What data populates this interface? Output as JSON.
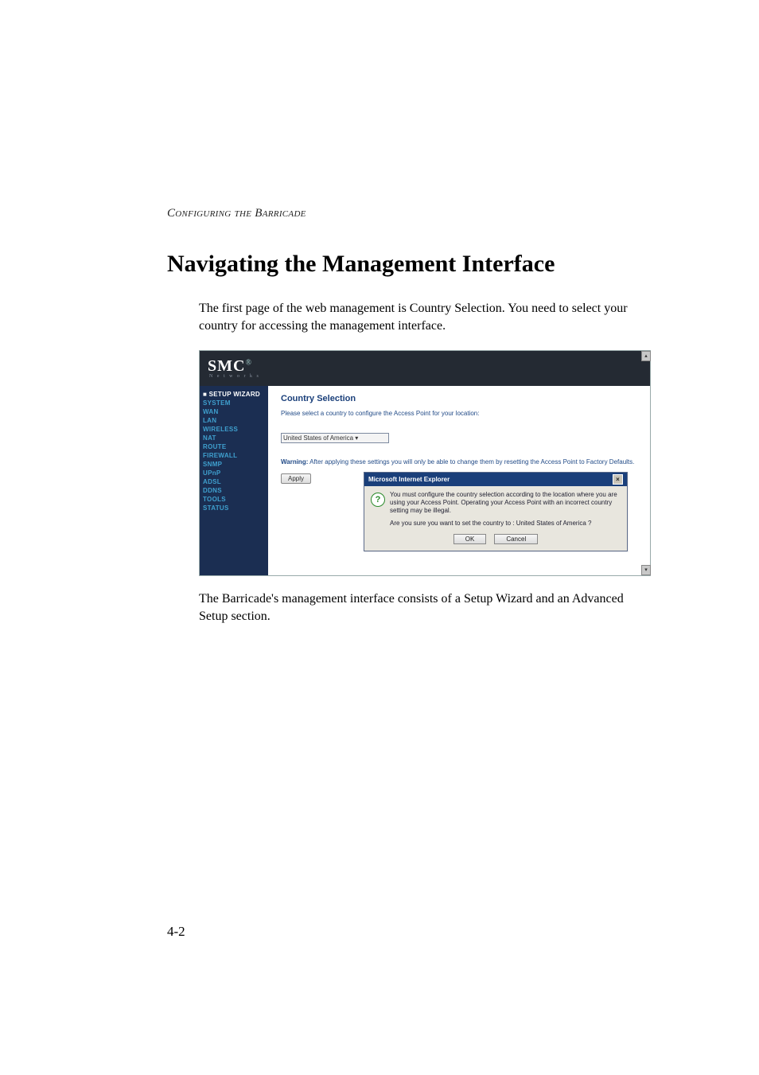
{
  "running_head": "Configuring the Barricade",
  "heading": "Navigating the Management Interface",
  "para1": "The first page of the web management is Country Selection. You need to select your country for accessing the management interface.",
  "para2": "The Barricade's management interface consists of a Setup Wizard and an Advanced Setup section.",
  "page_number": "4-2",
  "figure": {
    "brand": "SMC",
    "brand_mark": "®",
    "brand_sub": "N e t w o r k s",
    "sidebar": [
      "■ SETUP WIZARD",
      "SYSTEM",
      "WAN",
      "LAN",
      "WIRELESS",
      "NAT",
      "ROUTE",
      "FIREWALL",
      "SNMP",
      "UPnP",
      "ADSL",
      "DDNS",
      "TOOLS",
      "STATUS"
    ],
    "title": "Country Selection",
    "instruction": "Please select a country to configure the Access Point for your location:",
    "select_value": "United States of America ▾",
    "warning_label": "Warning:",
    "warning_text": "After applying these settings you will only be able to change them by resetting the Access Point to Factory Defaults.",
    "apply_label": "Apply",
    "dialog": {
      "title": "Microsoft Internet Explorer",
      "line1": "You must configure the country selection according to the location where you are using your Access Point. Operating your Access Point with an incorrect country setting may be illegal.",
      "line2": "Are you sure you want to set the country to : United States of America ?",
      "ok": "OK",
      "cancel": "Cancel"
    }
  }
}
